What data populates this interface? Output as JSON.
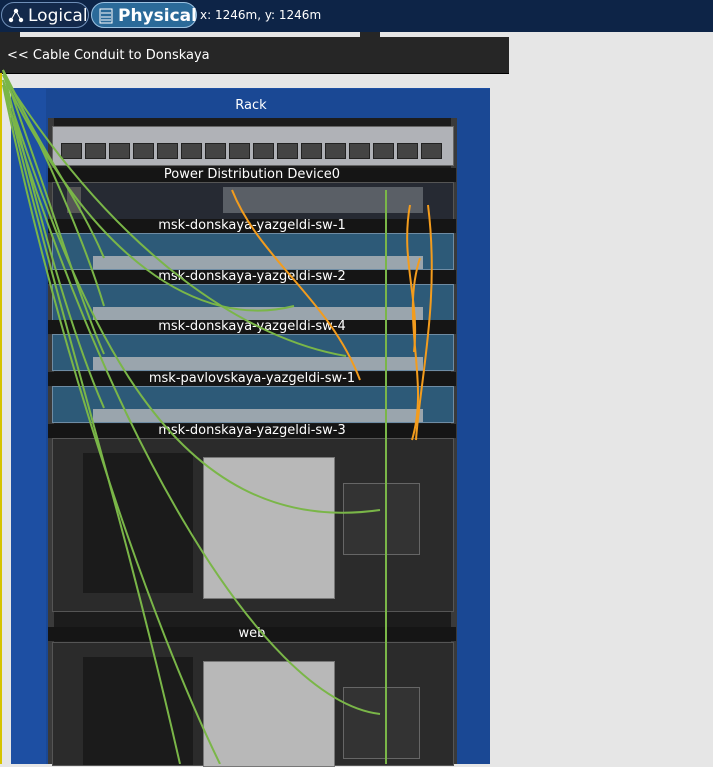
{
  "topbar": {
    "logical_label": "Logical",
    "physical_label": "Physical",
    "coords": "x: 1246m, y: 1246m"
  },
  "nav": {
    "back_link": "<< Cable Conduit to Donskaya"
  },
  "rack": {
    "title": "Rack",
    "devices": [
      "Power Distribution Device0",
      "msk-donskaya-yazgeldi-sw-1",
      "msk-donskaya-yazgeldi-sw-2",
      "msk-donskaya-yazgeldi-sw-4",
      "msk-pavlovskaya-yazgeldi-sw-1",
      "msk-donskaya-yazgeldi-sw-3",
      "web"
    ]
  },
  "colors": {
    "cable_green": "#7ab648",
    "cable_orange": "#f39c1d",
    "rack_blue": "#1d4fa3",
    "topbar": "#0d2447"
  }
}
